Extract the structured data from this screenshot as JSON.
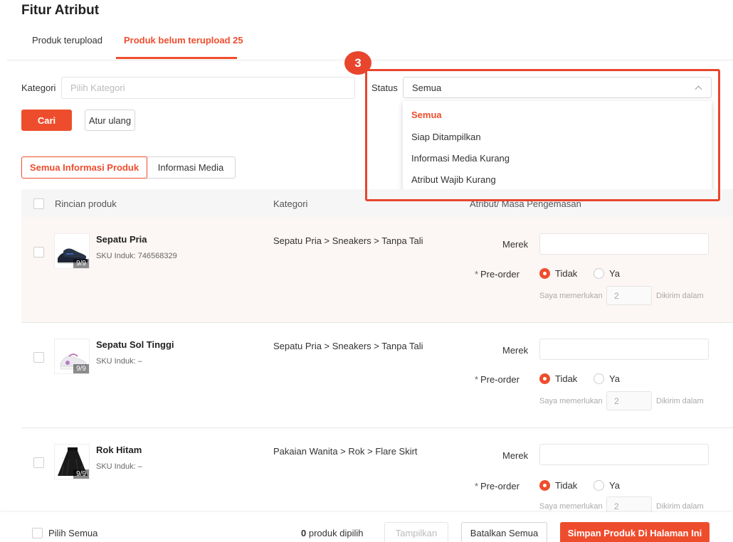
{
  "page": {
    "title": "Fitur Atribut"
  },
  "tabs": [
    {
      "label": "Produk terupload"
    },
    {
      "label": "Produk belum terupload 25"
    }
  ],
  "filters": {
    "kategori_label": "Kategori",
    "kategori_placeholder": "Pilih Kategori",
    "status_label": "Status",
    "status_value": "Semua",
    "search_label": "Cari",
    "reset_label": "Atur ulang"
  },
  "status_dropdown": {
    "options": [
      "Semua",
      "Siap Ditampilkan",
      "Informasi Media Kurang",
      "Atribut Wajib Kurang"
    ],
    "selected_index": 0
  },
  "annotation": {
    "step": "3",
    "color": "#e8452c"
  },
  "views": [
    {
      "label": "Semua Informasi Produk"
    },
    {
      "label": "Informasi Media"
    }
  ],
  "table": {
    "columns": [
      "Rincian produk",
      "Kategori",
      "Atribut/ Masa Pengemasan"
    ],
    "rows": [
      {
        "name": "Sepatu Pria",
        "sku": "SKU Induk: 746568329",
        "badge": "9/9",
        "category": "Sepatu Pria > Sneakers > Tanpa Tali"
      },
      {
        "name": "Sepatu Sol Tinggi",
        "sku": "SKU Induk: –",
        "badge": "9/9",
        "category": "Sepatu Pria > Sneakers > Tanpa Tali"
      },
      {
        "name": "Rok Hitam",
        "sku": "SKU Induk: –",
        "badge": "9/9",
        "category": "Pakaian Wanita > Rok > Flare Skirt"
      }
    ],
    "attr": {
      "merek_label": "Merek",
      "preorder_label": "Pre-order",
      "required_mark": "*",
      "no_label": "Tidak",
      "yes_label": "Ya",
      "need_label": "Saya memerlukan",
      "days_value": "2",
      "ship_label": "Dikirim dalam"
    }
  },
  "footer": {
    "select_all": "Pilih Semua",
    "selected_count": "0",
    "selected_text": "produk dipilih",
    "show_label": "Tampilkan",
    "cancel_all": "Batalkan Semua",
    "save_label": "Simpan Produk Di Halaman Ini"
  },
  "colors": {
    "accent": "#ee4d2d",
    "row_highlight": "#fcf6f4"
  }
}
